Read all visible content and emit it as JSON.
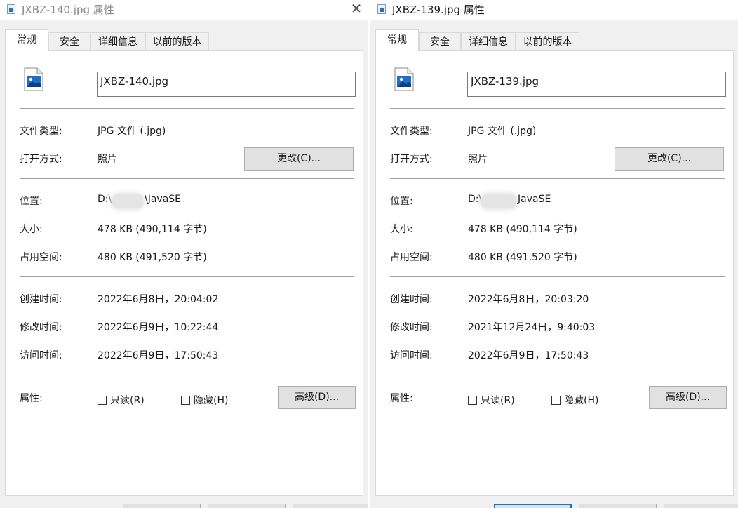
{
  "windows": [
    {
      "title": "JXBZ-140.jpg 属性",
      "close_glyph": "✕",
      "tabs": [
        "常规",
        "安全",
        "详细信息",
        "以前的版本"
      ],
      "active_tab": "常规",
      "file_name": "JXBZ-140.jpg",
      "file_type_label": "文件类型:",
      "file_type_value": "JPG 文件 (.jpg)",
      "open_with_label": "打开方式:",
      "open_with_value": "照片",
      "change_button": "更改(C)...",
      "location_label": "位置:",
      "location_prefix": "D:\\",
      "location_suffix": "\\JavaSE",
      "size_label": "大小:",
      "size_value": "478 KB (490,114 字节)",
      "disk_size_label": "占用空间:",
      "disk_size_value": "480 KB (491,520 字节)",
      "created_label": "创建时间:",
      "created_value": "2022年6月8日，20:04:02",
      "modified_label": "修改时间:",
      "modified_value": "2022年6月9日，10:22:44",
      "accessed_label": "访问时间:",
      "accessed_value": "2022年6月9日，17:50:43",
      "attributes_label": "属性:",
      "readonly_label": "只读(R)",
      "hidden_label": "隐藏(H)",
      "advanced_button": "高级(D)..."
    },
    {
      "title": "JXBZ-139.jpg 属性",
      "tabs": [
        "常规",
        "安全",
        "详细信息",
        "以前的版本"
      ],
      "active_tab": "常规",
      "file_name": "JXBZ-139.jpg",
      "file_type_label": "文件类型:",
      "file_type_value": "JPG 文件 (.jpg)",
      "open_with_label": "打开方式:",
      "open_with_value": "照片",
      "change_button": "更改(C)...",
      "location_label": "位置:",
      "location_prefix": "D:\\",
      "location_suffix": "JavaSE",
      "size_label": "大小:",
      "size_value": "478 KB (490,114 字节)",
      "disk_size_label": "占用空间:",
      "disk_size_value": "480 KB (491,520 字节)",
      "created_label": "创建时间:",
      "created_value": "2022年6月8日，20:03:20",
      "modified_label": "修改时间:",
      "modified_value": "2021年12月24日，9:40:03",
      "accessed_label": "访问时间:",
      "accessed_value": "2022年6月9日，17:50:43",
      "attributes_label": "属性:",
      "readonly_label": "只读(R)",
      "hidden_label": "隐藏(H)",
      "advanced_button": "高级(D)..."
    }
  ],
  "icons": {
    "title": "image-file-icon",
    "file": "jpg-file-icon",
    "close": "close-icon"
  },
  "colors": {
    "dialog_bg": "#f0f0f0",
    "panel_bg": "#ffffff",
    "button_bg": "#e1e1e1",
    "button_border": "#adadad",
    "separator": "#a0a0a0",
    "accent": "#0078d7"
  }
}
